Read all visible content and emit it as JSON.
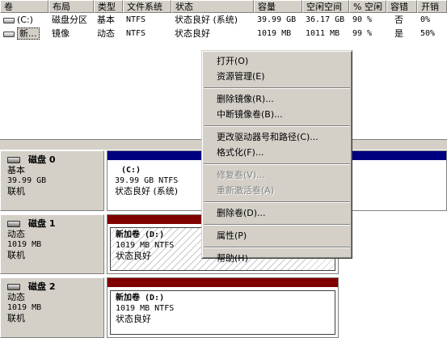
{
  "columns": [
    "卷",
    "布局",
    "类型",
    "文件系统",
    "状态",
    "容量",
    "空闲空间",
    "% 空闲",
    "容错",
    "开销"
  ],
  "volumes": [
    {
      "name": "(C:)",
      "layout": "磁盘分区",
      "type": "基本",
      "fs": "NTFS",
      "status": "状态良好 (系统)",
      "capacity": "39.99 GB",
      "free": "36.17 GB",
      "pct_free": "90 %",
      "fault_tolerance": "否",
      "overhead": "0%"
    },
    {
      "name": "新...",
      "layout": "镜像",
      "type": "动态",
      "fs": "NTFS",
      "status": "状态良好",
      "capacity": "1019 MB",
      "free": "1011 MB",
      "pct_free": "99 %",
      "fault_tolerance": "是",
      "overhead": "50%"
    }
  ],
  "disks": [
    {
      "title": "磁盘 0",
      "type": "基本",
      "size": "39.99 GB",
      "state": "联机",
      "bar_color": "#000080",
      "partition": {
        "name": "(C:)",
        "info": "39.99 GB NTFS",
        "status": "状态良好 (系统)"
      }
    },
    {
      "title": "磁盘 1",
      "type": "动态",
      "size": "1019 MB",
      "state": "联机",
      "bar_color": "#800000",
      "partition": {
        "name": "新加卷  (D:)",
        "info": "1019 MB NTFS",
        "status": "状态良好"
      }
    },
    {
      "title": "磁盘 2",
      "type": "动态",
      "size": "1019 MB",
      "state": "联机",
      "bar_color": "#800000",
      "partition": {
        "name": "新加卷  (D:)",
        "info": "1019 MB NTFS",
        "status": "状态良好"
      }
    }
  ],
  "context_menu": {
    "open": "打开(O)",
    "explore": "资源管理(E)",
    "remove_mirror": "删除镜像(R)...",
    "break_mirror": "中断镜像卷(B)...",
    "change_letter": "更改驱动器号和路径(C)...",
    "format": "格式化(F)...",
    "repair": "修复卷(V)...",
    "reactivate": "重新激活卷(A)",
    "delete": "删除卷(D)...",
    "properties": "属性(P)",
    "help": "帮助(H)"
  },
  "colors": {
    "basic_partition": "#000080",
    "mirrored_volume": "#800000",
    "window_bg": "#d4d0c8"
  }
}
